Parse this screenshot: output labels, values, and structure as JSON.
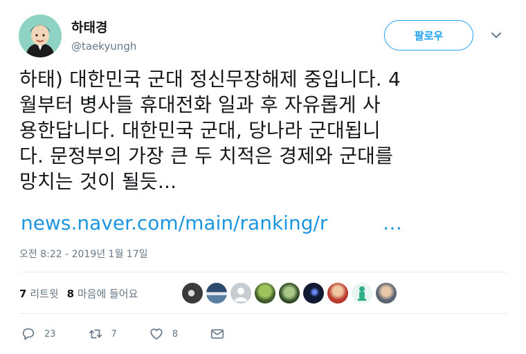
{
  "author": {
    "name": "하태경",
    "handle": "@taekyungh",
    "avatar_color": "#8fd3c4"
  },
  "follow_button": {
    "label": "팔로우",
    "color": "#1da1f2"
  },
  "more_menu_icon": "chevron-down-icon",
  "tweet": {
    "lines": [
      "하태) 대한민국 군대 정신무장해제 중입니다. 4",
      "월부터 병사들 휴대전화 일과 후 자유롭게 사",
      "용한답니다. 대한민국 군대, 당나라 군대됩니",
      "다. 문정부의 가장 큰 두 치적은 경제와 군대를",
      "망치는 것이 될듯..."
    ],
    "link_text": "news.naver.com/main/ranking/r",
    "link_ellipsis": "…",
    "link_color": "#1b95e0",
    "timestamp": "오전 8:22 - 2019년 1월 17일"
  },
  "stats": {
    "retweets_count": "7",
    "retweets_label": "리트윗",
    "likes_count": "8",
    "likes_label": "마음에 들어요"
  },
  "liker_avatars": [
    {
      "icon": "avatar-icon",
      "color": "#4a4a4a"
    },
    {
      "icon": "avatar-icon",
      "color": "#5b7fa0"
    },
    {
      "icon": "avatar-icon",
      "color": "#c7ccd1"
    },
    {
      "icon": "avatar-icon",
      "color": "#6b8e3a"
    },
    {
      "icon": "avatar-icon",
      "color": "#3e5a2a"
    },
    {
      "icon": "avatar-icon",
      "color": "#111a33"
    },
    {
      "icon": "avatar-icon",
      "color": "#b83a2e"
    },
    {
      "icon": "avatar-icon",
      "color": "#2fae88"
    },
    {
      "icon": "avatar-icon",
      "color": "#5a6470"
    }
  ],
  "actions": {
    "reply_count": "23",
    "retweet_count": "7",
    "like_count": "8"
  }
}
